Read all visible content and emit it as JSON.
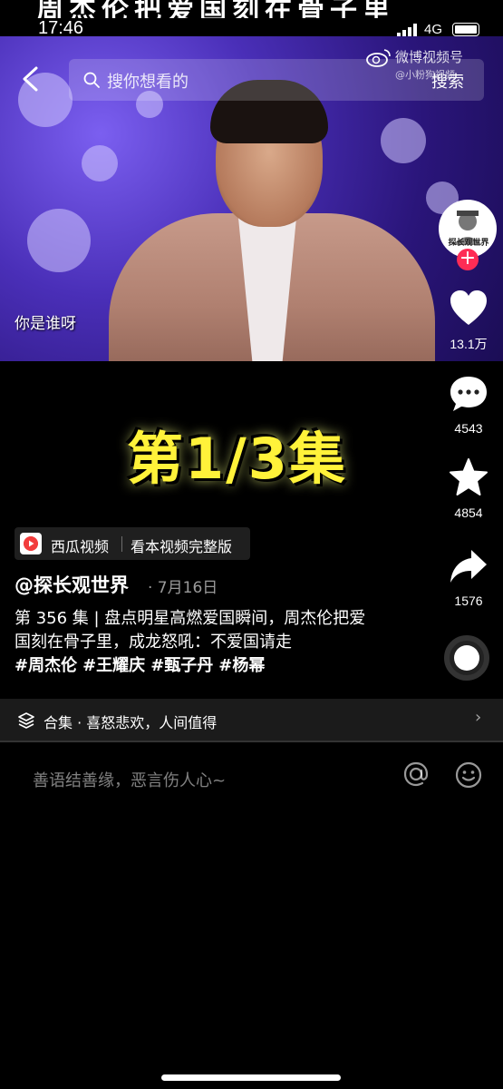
{
  "top_band": {
    "text": "周杰伦把爱国刻在骨子里"
  },
  "status_bar": {
    "time": "17:46",
    "network": "4G"
  },
  "header": {
    "search_placeholder": "搜你想看的",
    "search_button": "搜索",
    "watermark_brand": "微博视频号",
    "watermark_handle": "@小粉狗视频"
  },
  "video": {
    "caption": "你是谁呀",
    "episode_title": "第1/3集"
  },
  "actions": {
    "avatar_text": "探长观世界",
    "likes": "13.1万",
    "comments": "4543",
    "favorites": "4854",
    "shares": "1576"
  },
  "xigua": {
    "name": "西瓜视频",
    "cta": "看本视频完整版"
  },
  "post": {
    "author": "@探长观世界",
    "date": "· 7月16日",
    "description": "第 356 集 | 盘点明星高燃爱国瞬间，周杰伦把爱国刻在骨子里，成龙怒吼：不爱国请走",
    "hashtags": [
      "#周杰伦",
      "#王耀庆",
      "#甄子丹",
      "#杨幂"
    ]
  },
  "collection": {
    "label": "合集 · 喜怒悲欢，人间值得"
  },
  "comment": {
    "placeholder": "善语结善缘，恶言伤人心~"
  },
  "colors": {
    "follow": "#fe2c55",
    "episode_title": "#fff23a",
    "xigua_red": "#f23c3c"
  },
  "icons": [
    "back-arrow",
    "search",
    "weibo-logo",
    "heart",
    "comment-bubble",
    "star",
    "share-arrow",
    "collection-stack",
    "at-sign",
    "emoji-face",
    "chevron-right"
  ]
}
